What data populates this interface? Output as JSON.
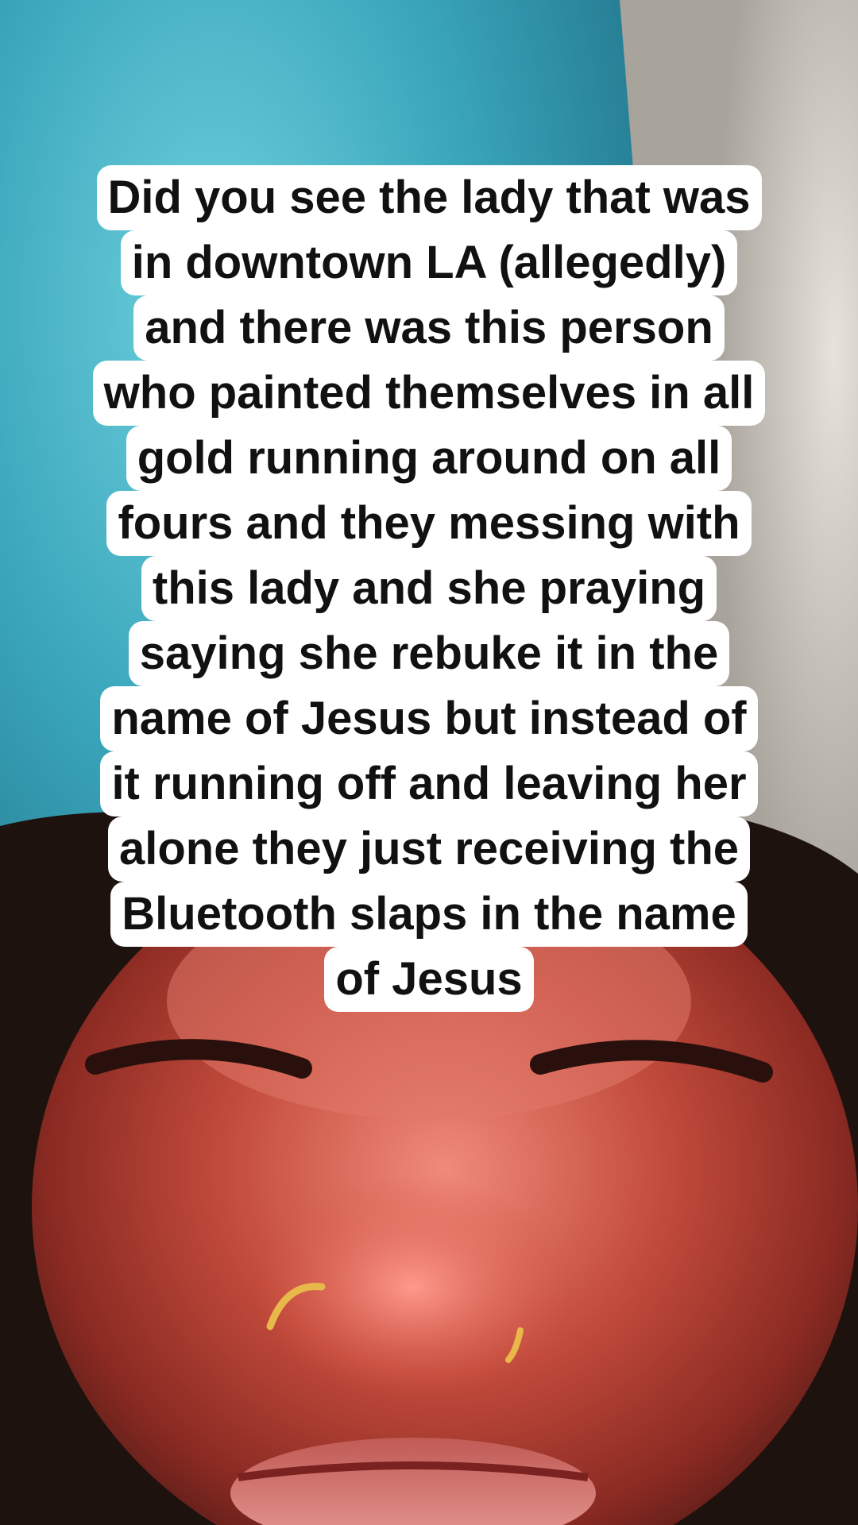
{
  "caption": {
    "lines": [
      "Did you see the lady that was",
      "in downtown LA (allegedly)",
      "and there was this person",
      "who painted themselves in all",
      "gold running around on all",
      "fours and they messing with",
      "this lady and she praying",
      "saying she rebuke it in the",
      "name of Jesus but instead of",
      "it running off and leaving her",
      "alone they just receiving the",
      "Bluetooth slaps in the name",
      "of Jesus"
    ]
  },
  "colors": {
    "caption_background": "#ffffff",
    "caption_text": "#111111",
    "blanket_teal": "#3fb2c4",
    "skin": "#b5453a"
  }
}
